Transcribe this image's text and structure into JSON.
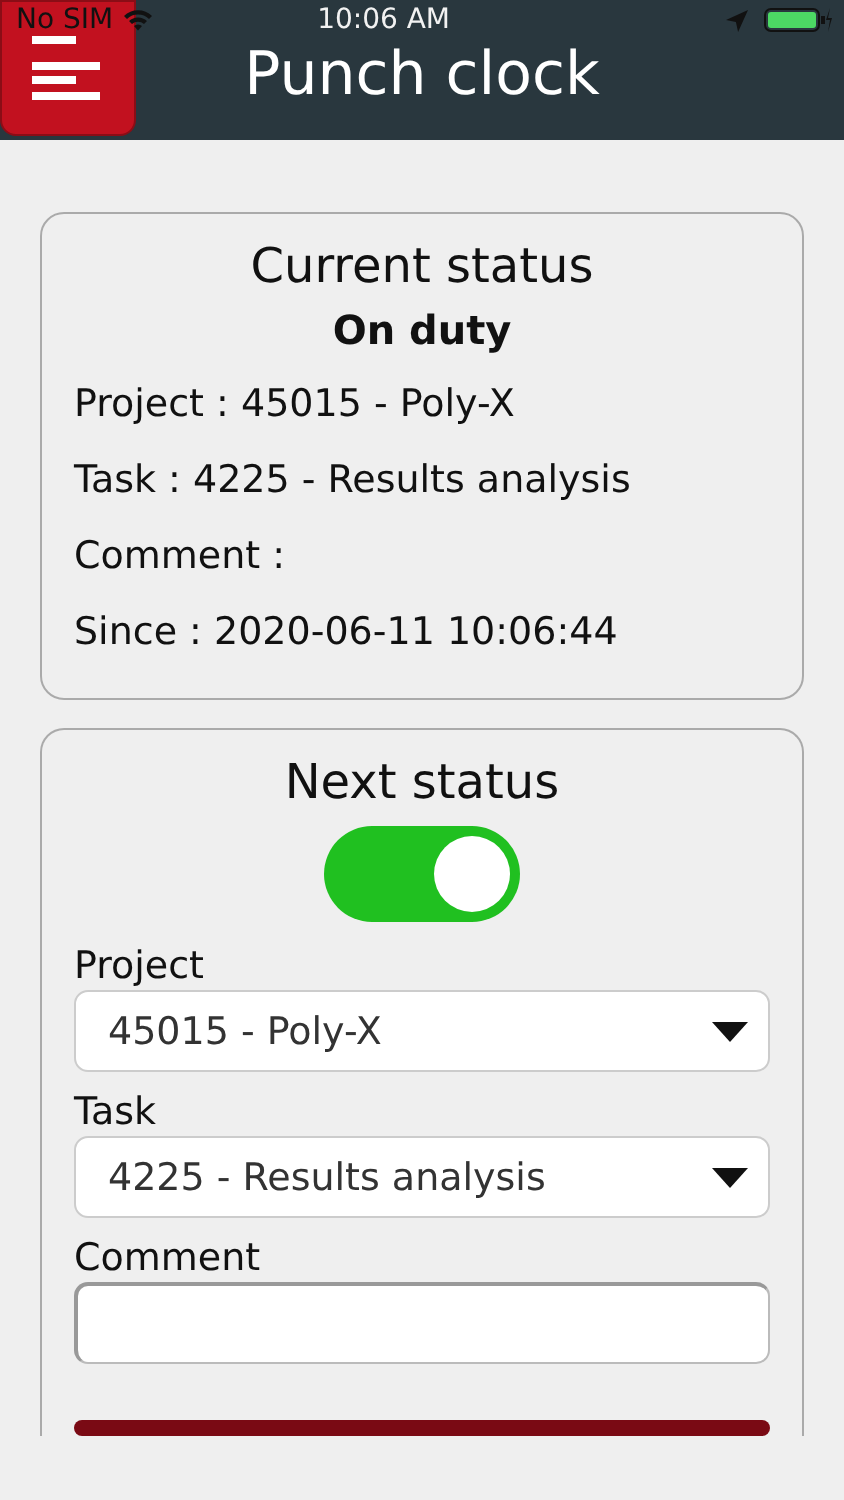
{
  "status_bar": {
    "carrier": "No SIM",
    "time": "10:06 AM"
  },
  "header": {
    "title": "Punch clock"
  },
  "current_status": {
    "title": "Current status",
    "state": "On duty",
    "rows": [
      {
        "label": "Project :",
        "value": "45015 - Poly-X"
      },
      {
        "label": "Task :",
        "value": "4225 - Results analysis"
      },
      {
        "label": "Comment :"
      },
      {
        "label": "Since :",
        "value": "2020-06-11 10:06:44"
      }
    ]
  },
  "next_status": {
    "title": "Next status",
    "on_duty": true,
    "fields": [
      {
        "kind": "select",
        "label": "Project",
        "value": "45015 - Poly-X"
      },
      {
        "kind": "select",
        "label": "Task",
        "value": "4225 - Results analysis"
      },
      {
        "kind": "text",
        "label": "Comment"
      }
    ]
  }
}
